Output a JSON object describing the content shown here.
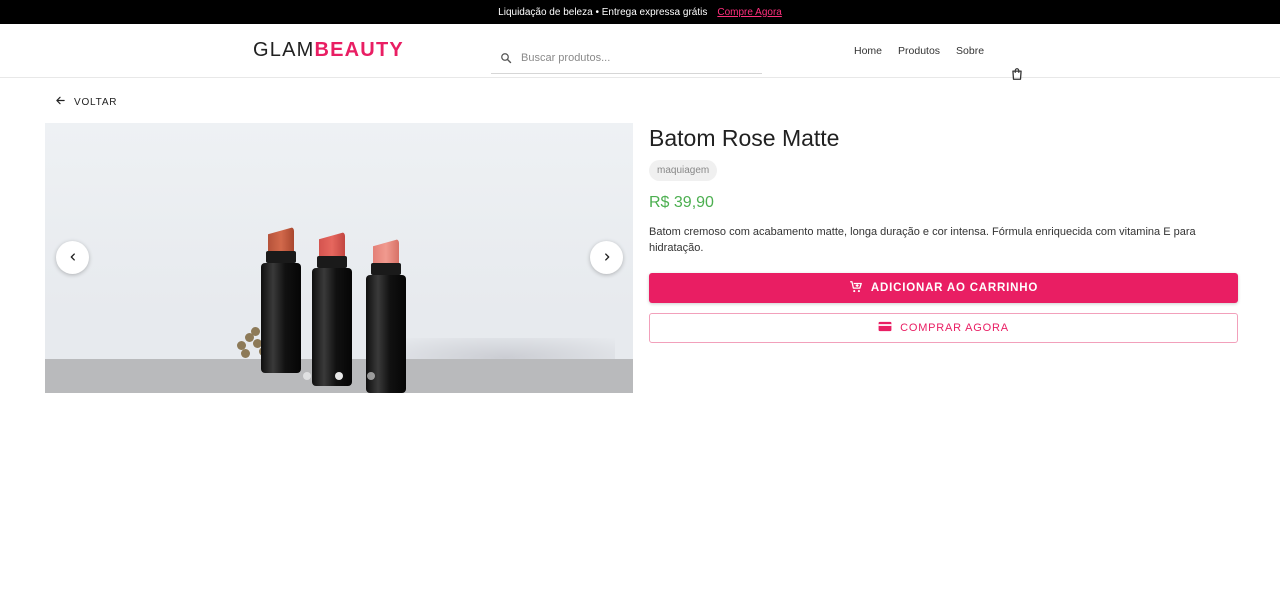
{
  "promo": {
    "text": "Liquidação de beleza • Entrega expressa grátis",
    "link": "Compre Agora"
  },
  "header": {
    "logo_part1": "GLAM",
    "logo_part2": "BEAUTY",
    "search_placeholder": "Buscar produtos...",
    "nav": [
      "Home",
      "Produtos",
      "Sobre"
    ]
  },
  "back_label": "VOLTAR",
  "gallery": {
    "image_count": 3,
    "active_index": 1
  },
  "product": {
    "title": "Batom Rose Matte",
    "category": "maquiagem",
    "price": "R$ 39,90",
    "description": "Batom cremoso com acabamento matte, longa duração e cor intensa. Fórmula enriquecida com vitamina E para hidratação.",
    "add_to_cart_label": "ADICIONAR AO CARRINHO",
    "buy_now_label": "COMPRAR AGORA"
  },
  "colors": {
    "brand": "#e91e63",
    "price": "#4caf50"
  }
}
